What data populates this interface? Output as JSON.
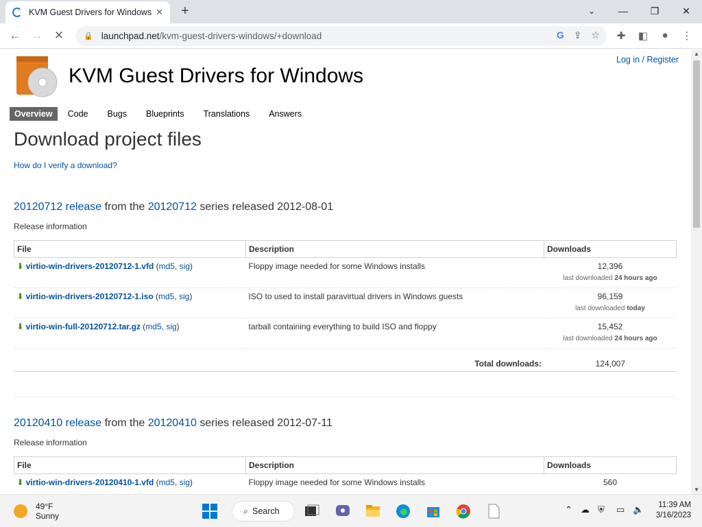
{
  "browser": {
    "tab_title": "KVM Guest Drivers for Windows",
    "url_host": "launchpad.net",
    "url_path": "/kvm-guest-drivers-windows/+download"
  },
  "header": {
    "login_label": "Log in / Register",
    "project_title": "KVM Guest Drivers for Windows"
  },
  "nav_tabs": [
    "Overview",
    "Code",
    "Bugs",
    "Blueprints",
    "Translations",
    "Answers"
  ],
  "main": {
    "heading": "Download project files",
    "verify_link": "How do I verify a download?"
  },
  "release1": {
    "release_link": "20120712 release",
    "from_text": "from the",
    "series_link": "20120712",
    "released_text": "series released 2012-08-01",
    "info": "Release information",
    "columns": [
      "File",
      "Description",
      "Downloads"
    ],
    "rows": [
      {
        "file": "virtio-win-drivers-20120712-1.vfd",
        "md5": "md5",
        "sig": "sig",
        "description": "Floppy image needed for some Windows installs",
        "downloads": "12,396",
        "last_prefix": "last downloaded",
        "last": "24 hours ago"
      },
      {
        "file": "virtio-win-drivers-20120712-1.iso",
        "md5": "md5",
        "sig": "sig",
        "description": "ISO to used to install paravirtual drivers in Windows guests",
        "downloads": "96,159",
        "last_prefix": "last downloaded",
        "last": "today"
      },
      {
        "file": "virtio-win-full-20120712.tar.gz",
        "md5": "md5",
        "sig": "sig",
        "description": "tarball containing everything to build ISO and floppy",
        "downloads": "15,452",
        "last_prefix": "last downloaded",
        "last": "24 hours ago"
      }
    ],
    "total_label": "Total downloads:",
    "total_value": "124,007"
  },
  "release2": {
    "release_link": "20120410 release",
    "from_text": "from the",
    "series_link": "20120410",
    "released_text": "series released 2012-07-11",
    "info": "Release information",
    "columns": [
      "File",
      "Description",
      "Downloads"
    ],
    "rows": [
      {
        "file": "virtio-win-drivers-20120410-1.vfd",
        "md5": "md5",
        "sig": "sig",
        "description": "Floppy image needed for some Windows installs",
        "downloads": "560"
      }
    ]
  },
  "taskbar": {
    "temperature": "49°F",
    "condition": "Sunny",
    "search_label": "Search",
    "time": "11:39 AM",
    "date": "3/16/2023"
  },
  "colors": {
    "link": "#0053a0",
    "download_arrow": "#3a8b1c",
    "active_tab_bg": "#666666"
  }
}
